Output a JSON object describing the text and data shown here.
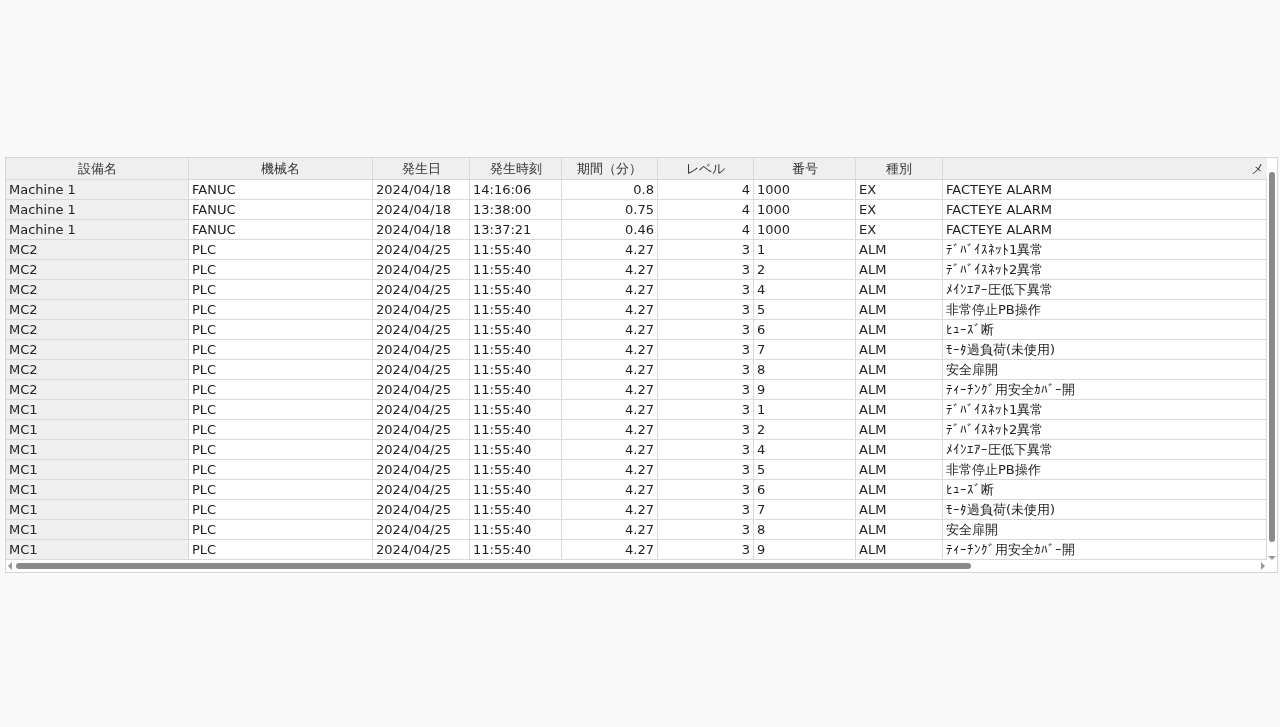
{
  "table": {
    "columns": [
      "設備名",
      "機械名",
      "発生日",
      "発生時刻",
      "期間（分）",
      "レベル",
      "番号",
      "種別",
      "メ"
    ],
    "rows": [
      [
        "Machine 1",
        "FANUC",
        "2024/04/18",
        "14:16:06",
        "0.8",
        "4",
        "1000",
        "EX",
        "FACTEYE ALARM"
      ],
      [
        "Machine 1",
        "FANUC",
        "2024/04/18",
        "13:38:00",
        "0.75",
        "4",
        "1000",
        "EX",
        "FACTEYE ALARM"
      ],
      [
        "Machine 1",
        "FANUC",
        "2024/04/18",
        "13:37:21",
        "0.46",
        "4",
        "1000",
        "EX",
        "FACTEYE ALARM"
      ],
      [
        "MC2",
        "PLC",
        "2024/04/25",
        "11:55:40",
        "4.27",
        "3",
        "1",
        "ALM",
        "ﾃﾞﾊﾞｲｽﾈｯﾄ1異常"
      ],
      [
        "MC2",
        "PLC",
        "2024/04/25",
        "11:55:40",
        "4.27",
        "3",
        "2",
        "ALM",
        "ﾃﾞﾊﾞｲｽﾈｯﾄ2異常"
      ],
      [
        "MC2",
        "PLC",
        "2024/04/25",
        "11:55:40",
        "4.27",
        "3",
        "4",
        "ALM",
        "ﾒｲﾝｴｱｰ圧低下異常"
      ],
      [
        "MC2",
        "PLC",
        "2024/04/25",
        "11:55:40",
        "4.27",
        "3",
        "5",
        "ALM",
        "非常停止PB操作"
      ],
      [
        "MC2",
        "PLC",
        "2024/04/25",
        "11:55:40",
        "4.27",
        "3",
        "6",
        "ALM",
        "ﾋｭｰｽﾞ断"
      ],
      [
        "MC2",
        "PLC",
        "2024/04/25",
        "11:55:40",
        "4.27",
        "3",
        "7",
        "ALM",
        "ﾓｰﾀ過負荷(未使用)"
      ],
      [
        "MC2",
        "PLC",
        "2024/04/25",
        "11:55:40",
        "4.27",
        "3",
        "8",
        "ALM",
        "安全扉開"
      ],
      [
        "MC2",
        "PLC",
        "2024/04/25",
        "11:55:40",
        "4.27",
        "3",
        "9",
        "ALM",
        "ﾃｨｰﾁﾝｸﾞ用安全ｶﾊﾞｰ開"
      ],
      [
        "MC1",
        "PLC",
        "2024/04/25",
        "11:55:40",
        "4.27",
        "3",
        "1",
        "ALM",
        "ﾃﾞﾊﾞｲｽﾈｯﾄ1異常"
      ],
      [
        "MC1",
        "PLC",
        "2024/04/25",
        "11:55:40",
        "4.27",
        "3",
        "2",
        "ALM",
        "ﾃﾞﾊﾞｲｽﾈｯﾄ2異常"
      ],
      [
        "MC1",
        "PLC",
        "2024/04/25",
        "11:55:40",
        "4.27",
        "3",
        "4",
        "ALM",
        "ﾒｲﾝｴｱｰ圧低下異常"
      ],
      [
        "MC1",
        "PLC",
        "2024/04/25",
        "11:55:40",
        "4.27",
        "3",
        "5",
        "ALM",
        "非常停止PB操作"
      ],
      [
        "MC1",
        "PLC",
        "2024/04/25",
        "11:55:40",
        "4.27",
        "3",
        "6",
        "ALM",
        "ﾋｭｰｽﾞ断"
      ],
      [
        "MC1",
        "PLC",
        "2024/04/25",
        "11:55:40",
        "4.27",
        "3",
        "7",
        "ALM",
        "ﾓｰﾀ過負荷(未使用)"
      ],
      [
        "MC1",
        "PLC",
        "2024/04/25",
        "11:55:40",
        "4.27",
        "3",
        "8",
        "ALM",
        "安全扉開"
      ],
      [
        "MC1",
        "PLC",
        "2024/04/25",
        "11:55:40",
        "4.27",
        "3",
        "9",
        "ALM",
        "ﾃｨｰﾁﾝｸﾞ用安全ｶﾊﾞｰ開"
      ]
    ]
  }
}
